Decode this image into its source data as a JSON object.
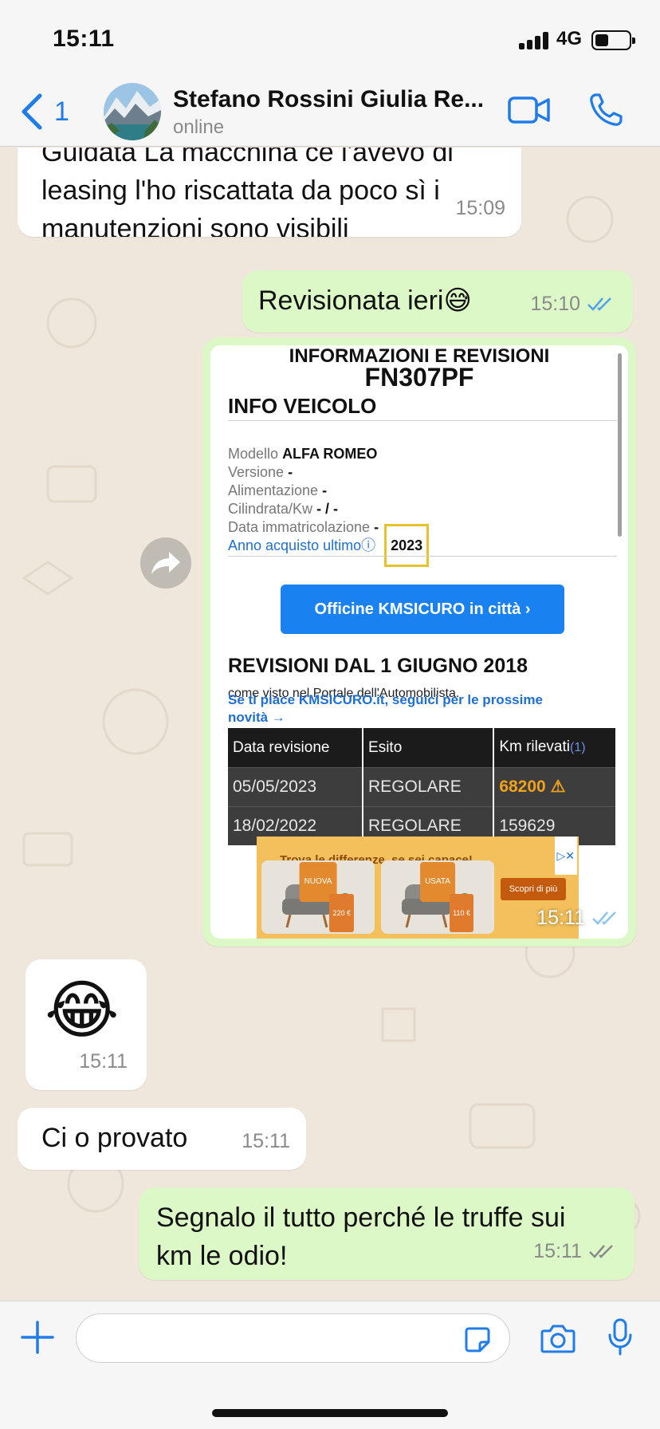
{
  "status_bar": {
    "time": "15:11",
    "network": "4G",
    "battery_level": 0.4
  },
  "header": {
    "back_count": "1",
    "contact_name": "Stefano Rossini Giulia Re...",
    "contact_status": "online",
    "accent_color": "#1f7ce8"
  },
  "messages": [
    {
      "direction": "in",
      "text_line1": "Guidata La macchina ce l'avevo di",
      "text": "leasing l'ho riscattata da poco sì i manutenzioni sono visibili",
      "time": "15:09"
    },
    {
      "direction": "out",
      "text": "Revisionata ieri😅",
      "time": "15:10"
    },
    {
      "direction": "out",
      "type": "image",
      "time": "15:11"
    },
    {
      "direction": "in",
      "type": "emoji",
      "text": "😂",
      "time": "15:11"
    },
    {
      "direction": "in",
      "text": "Ci o provato",
      "time": "15:11"
    },
    {
      "direction": "out",
      "text": "Segnalo il tutto perché le truffe sui km le odio!",
      "time": "15:11"
    }
  ],
  "screenshot": {
    "heading": "INFORMAZIONI E REVISIONI",
    "plate": "FN307PF",
    "info_title": "INFO VEICOLO",
    "fields": [
      {
        "label": "Modello",
        "value": "ALFA ROMEO"
      },
      {
        "label": "Versione",
        "value": "-"
      },
      {
        "label": "Alimentazione",
        "value": "-"
      },
      {
        "label": "Cilindrata/Kw",
        "value": "- / -"
      },
      {
        "label": "Data immatricolazione",
        "value": "-"
      }
    ],
    "purchase_label": "Anno acquisto ultimo",
    "purchase_year": "2023",
    "button_label": "Officine KMSICURO in città ›",
    "revisions_title": "REVISIONI DAL 1 GIUGNO 2018",
    "revisions_source": "come visto nel Portale dell'Automobilista.",
    "follow_text": "Se ti piace KMSICURO.it, seguici per le prossime novità →",
    "table": {
      "headers": [
        "Data revisione",
        "Esito",
        "Km rilevati"
      ],
      "header_ref": "(1)",
      "rows": [
        {
          "date": "05/05/2023",
          "result": "REGOLARE",
          "km": "68200",
          "warning": "⚠"
        },
        {
          "date": "18/02/2022",
          "result": "REGOLARE",
          "km": "159629",
          "warning": ""
        }
      ]
    },
    "ad": {
      "title": "Trova le differenze, se sei capace!",
      "tag_new": "NUOVA",
      "tag_used": "USATA",
      "price_new": "220 €",
      "price_used": "110 €",
      "cta": "Scopri di più"
    }
  },
  "colors": {
    "incoming_bubble": "#ffffff",
    "outgoing_bubble": "#dcf8c6",
    "read_tick": "#4fa3e8",
    "wallpaper": "#efe7dc"
  },
  "icons": {
    "back": "chevron-left-icon",
    "video_call": "video-camera-icon",
    "voice_call": "phone-icon",
    "forward": "forward-arrow-icon",
    "attach": "plus-icon",
    "sticker": "sticker-icon",
    "camera": "camera-icon",
    "microphone": "microphone-icon"
  }
}
